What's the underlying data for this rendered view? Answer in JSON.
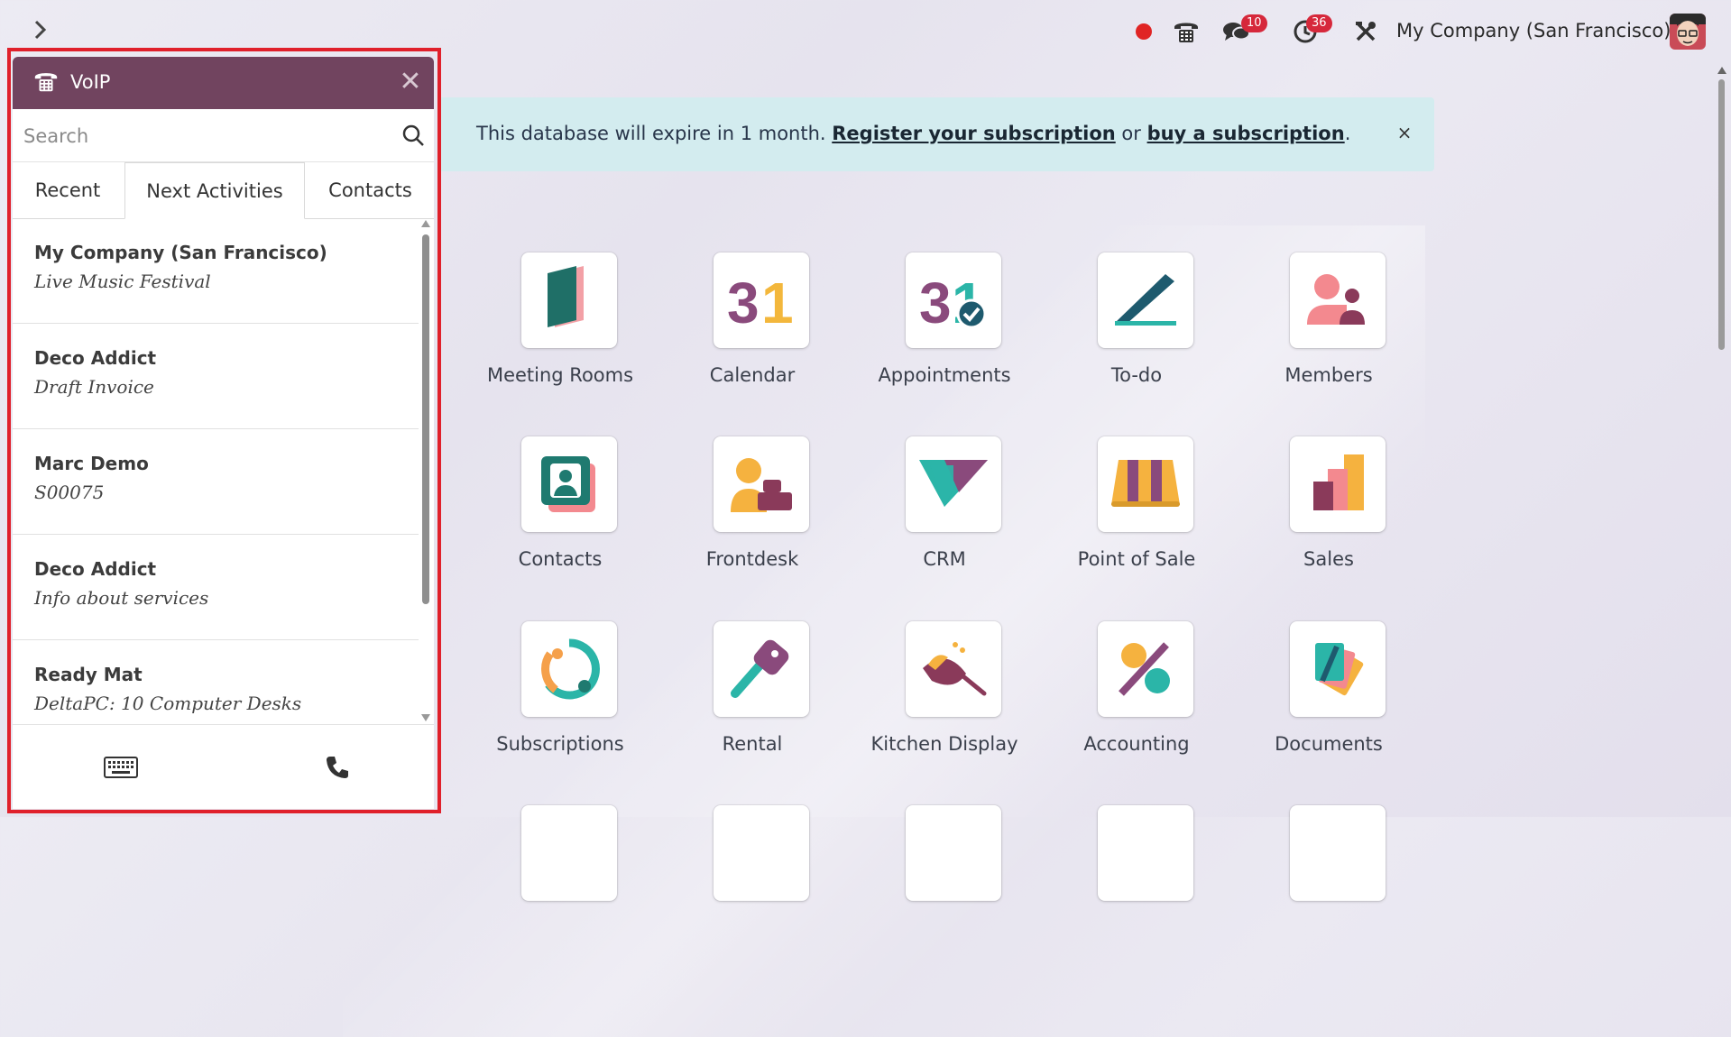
{
  "topbar": {
    "messages_badge": "10",
    "activities_badge": "36",
    "company": "My Company (San Francisco)"
  },
  "banner": {
    "text_before": "This database will expire in 1 month. ",
    "link1": "Register your subscription",
    "text_middle": " or ",
    "link2": "buy a subscription",
    "text_after": ".",
    "close": "×"
  },
  "apps": [
    {
      "label": "Meeting Rooms",
      "icon": "meeting-rooms-icon"
    },
    {
      "label": "Calendar",
      "icon": "calendar-icon"
    },
    {
      "label": "Appointments",
      "icon": "appointments-icon"
    },
    {
      "label": "To-do",
      "icon": "todo-icon"
    },
    {
      "label": "Members",
      "icon": "members-icon"
    },
    {
      "label": "Contacts",
      "icon": "contacts-icon"
    },
    {
      "label": "Frontdesk",
      "icon": "frontdesk-icon"
    },
    {
      "label": "CRM",
      "icon": "crm-icon"
    },
    {
      "label": "Point of Sale",
      "icon": "point-of-sale-icon"
    },
    {
      "label": "Sales",
      "icon": "sales-icon"
    },
    {
      "label": "Subscriptions",
      "icon": "subscriptions-icon"
    },
    {
      "label": "Rental",
      "icon": "rental-icon"
    },
    {
      "label": "Kitchen Display",
      "icon": "kitchen-display-icon"
    },
    {
      "label": "Accounting",
      "icon": "accounting-icon"
    },
    {
      "label": "Documents",
      "icon": "documents-icon"
    }
  ],
  "calendar_icon_text": "31",
  "voip": {
    "title": "VoIP",
    "close": "✕",
    "search_placeholder": "Search",
    "tabs": [
      "Recent",
      "Next Activities",
      "Contacts"
    ],
    "active_tab": "Next Activities",
    "items": [
      {
        "name": "My Company (San Francisco)",
        "sub": "Live Music Festival"
      },
      {
        "name": "Deco Addict",
        "sub": "Draft Invoice"
      },
      {
        "name": "Marc Demo",
        "sub": "S00075"
      },
      {
        "name": "Deco Addict",
        "sub": "Info about services"
      },
      {
        "name": "Ready Mat",
        "sub": "DeltaPC: 10 Computer Desks"
      }
    ]
  },
  "colors": {
    "voip_header": "#71445f",
    "badge": "#d6283b",
    "recording_dot": "#e02424",
    "banner_bg": "#d3ecef",
    "highlight_outline": "#e0202b"
  }
}
